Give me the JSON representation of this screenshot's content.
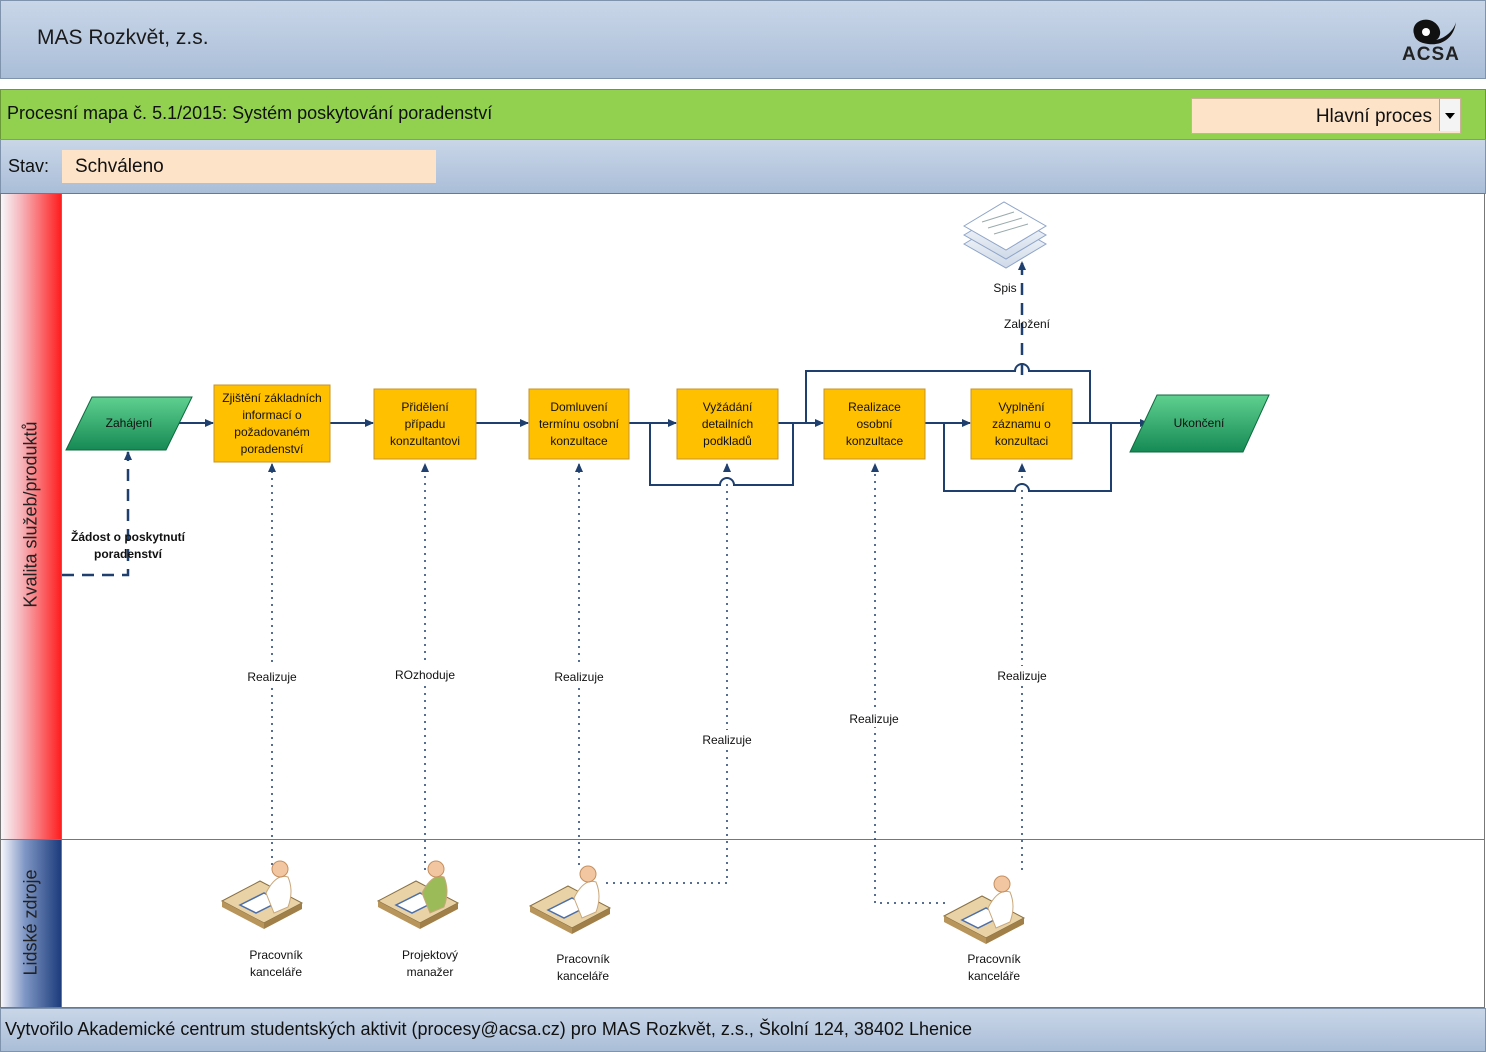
{
  "header": {
    "org_name": "MAS Rozkvět, z.s.",
    "logo_text": "ACSA"
  },
  "title_bar": {
    "map_title": "Procesní mapa č. 5.1/2015: Systém poskytování poradenství",
    "process_type": "Hlavní proces"
  },
  "status": {
    "label": "Stav:",
    "value": "Schváleno"
  },
  "lanes": {
    "quality": "Kvalita služeb/produktů",
    "hr": "Lidské zdroje"
  },
  "diagram": {
    "start": "Zahájení",
    "end": "Ukončení",
    "steps": [
      {
        "lines": [
          "Zjištění základních",
          "informací o",
          "požadovaném",
          "poradenství"
        ]
      },
      {
        "lines": [
          "Přidělení",
          "případu",
          "konzultantovi"
        ]
      },
      {
        "lines": [
          "Domluvení",
          "termínu osobní",
          "konzultace"
        ]
      },
      {
        "lines": [
          "Vyžádání",
          "detailních",
          "podkladů"
        ]
      },
      {
        "lines": [
          "Realizace",
          "osobní",
          "konzultace"
        ]
      },
      {
        "lines": [
          "Vyplnění",
          "záznamu o",
          "konzultaci"
        ]
      }
    ],
    "input_label": [
      "Žádost o poskytnutí",
      "poradenství"
    ],
    "document": {
      "name": "Spis",
      "relation": "Založení"
    },
    "relations": [
      "Realizuje",
      "ROzhoduje",
      "Realizuje",
      "Realizuje",
      "Realizuje",
      "Realizuje"
    ],
    "roles": [
      {
        "lines": [
          "Pracovník",
          "kanceláře"
        ]
      },
      {
        "lines": [
          "Projektový",
          "manažer"
        ]
      },
      {
        "lines": [
          "Pracovník",
          "kanceláře"
        ]
      },
      {
        "lines": [
          "Pracovník",
          "kanceláře"
        ]
      }
    ]
  },
  "footer": {
    "text": "Vytvořilo Akademické centrum studentských aktivit (procesy@acsa.cz) pro MAS Rozkvět, z.s., Školní 124, 38402 Lhenice"
  },
  "colors": {
    "step_fill": "#ffc000",
    "step_border": "#c7932a",
    "start_end_fill": "#2bb673",
    "connector": "#1f3f6e",
    "title_bar": "#92d050",
    "status_box": "#fde3c8"
  }
}
